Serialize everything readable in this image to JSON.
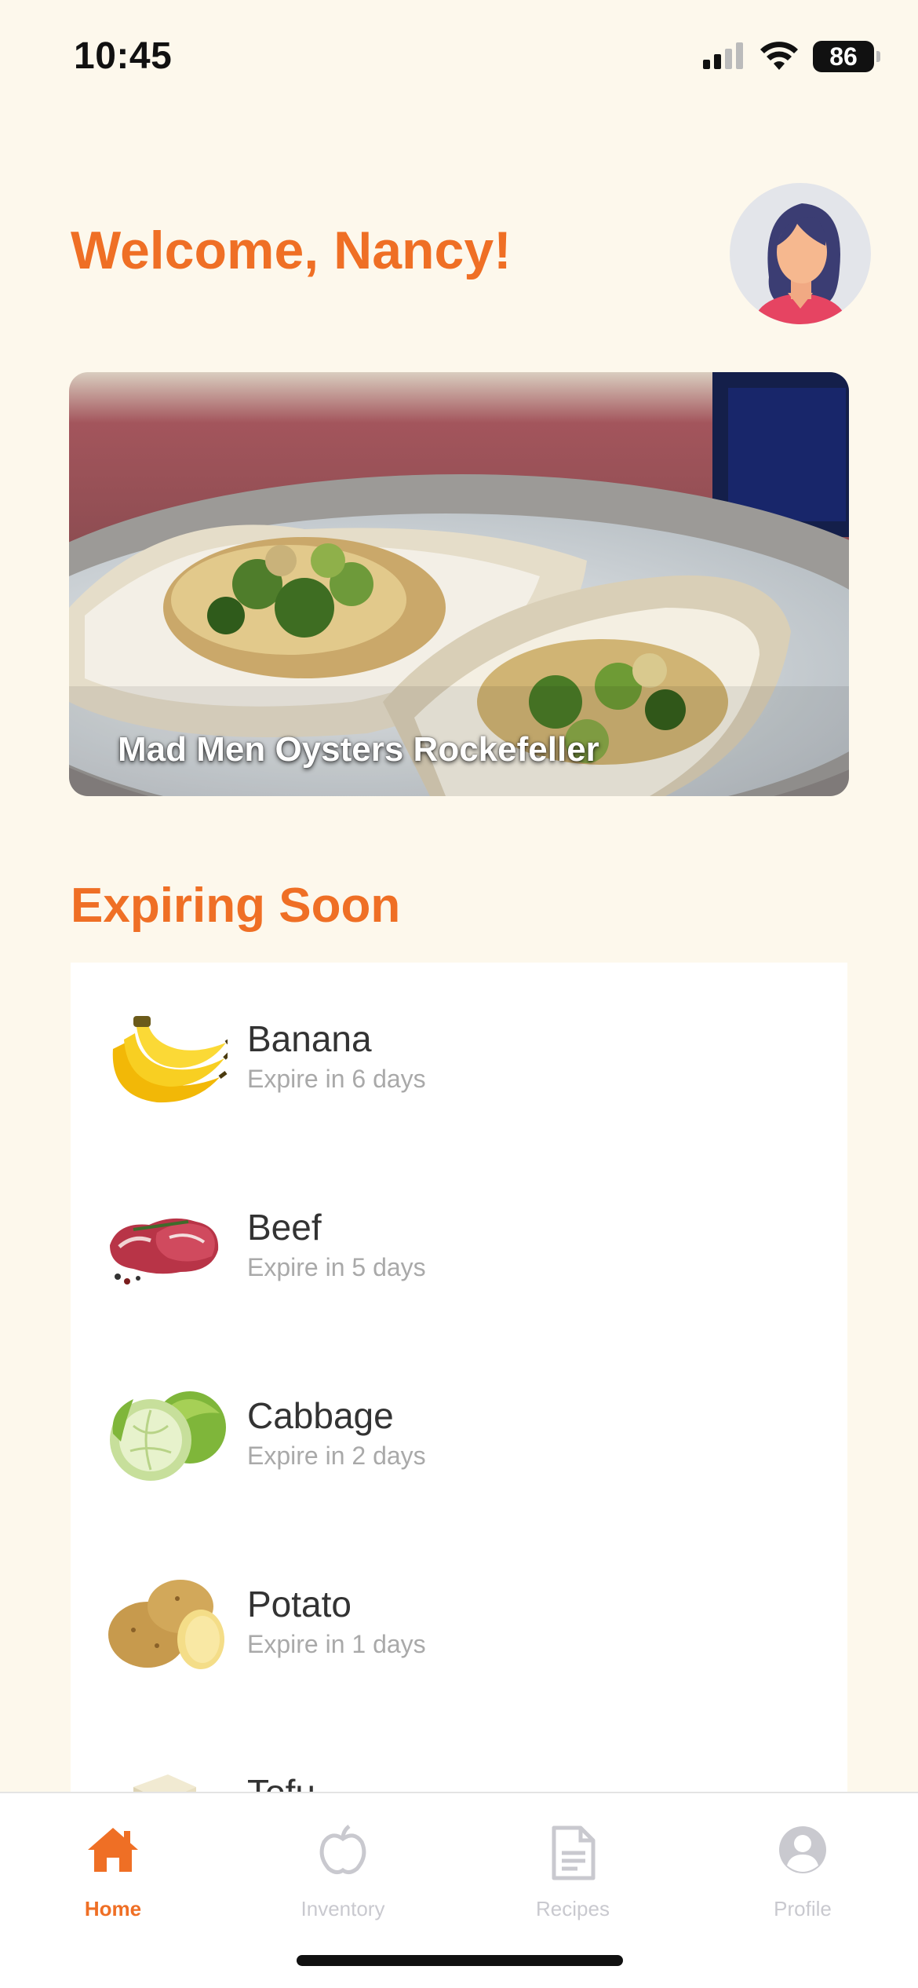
{
  "status": {
    "time": "10:45",
    "battery": "86"
  },
  "header": {
    "greeting": "Welcome, Nancy!"
  },
  "featured": {
    "title": "Mad Men Oysters Rockefeller"
  },
  "expiring": {
    "title": "Expiring Soon",
    "items": [
      {
        "name": "Banana",
        "expiry": "Expire in 6 days",
        "icon": "banana-icon"
      },
      {
        "name": "Beef",
        "expiry": "Expire in 5 days",
        "icon": "beef-icon"
      },
      {
        "name": "Cabbage",
        "expiry": "Expire in 2 days",
        "icon": "cabbage-icon"
      },
      {
        "name": "Potato",
        "expiry": "Expire in 1 days",
        "icon": "potato-icon"
      },
      {
        "name": "Tofu",
        "expiry": "",
        "icon": "tofu-icon"
      }
    ]
  },
  "tabs": [
    {
      "label": "Home",
      "icon": "home-icon",
      "active": true
    },
    {
      "label": "Inventory",
      "icon": "apple-icon",
      "active": false
    },
    {
      "label": "Recipes",
      "icon": "document-icon",
      "active": false
    },
    {
      "label": "Profile",
      "icon": "person-icon",
      "active": false
    }
  ],
  "colors": {
    "accent": "#ef6f25",
    "background": "#fdf8ec",
    "inactive": "#c9c9cf"
  }
}
